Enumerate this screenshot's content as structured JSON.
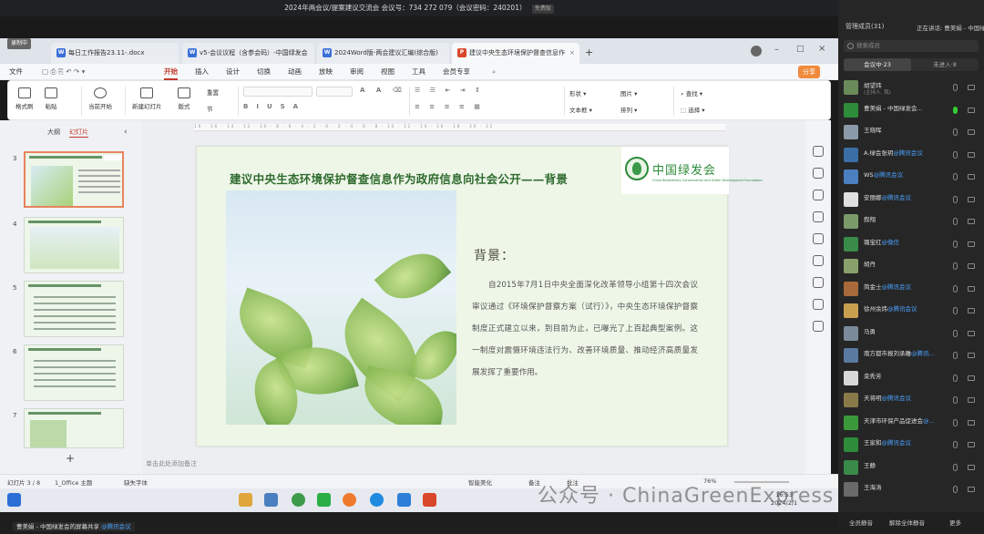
{
  "meeting": {
    "title": "2024年两会议/提案建议交流会  会议号：734 272 079（会议密码：240201）",
    "tag": "免费版",
    "recording_label": "录制中"
  },
  "tabs": [
    {
      "label": "每日工作报告23.11-.docx",
      "icon": "W"
    },
    {
      "label": "v5-会议议程（含参会码）-中国绿发会",
      "icon": "W"
    },
    {
      "label": "2024Word版-两会建议汇编(综合版)",
      "icon": "W"
    },
    {
      "label": "建议中央生态环境保护督查信息作",
      "icon": "P"
    }
  ],
  "menu": {
    "file": "文件",
    "items": [
      "开始",
      "插入",
      "设计",
      "切换",
      "动画",
      "放映",
      "审阅",
      "视图",
      "工具",
      "会员专享"
    ],
    "share": "分享"
  },
  "ribbon": {
    "format_painter": "格式刷",
    "paste": "粘贴",
    "play_from_current": "当前开始",
    "new_slide": "新建幻灯片",
    "layout": "版式",
    "reset": "重置",
    "section": "节",
    "shape": "形状",
    "picture": "图片",
    "textbox": "文本框",
    "arrange": "排列",
    "find": "查找",
    "select": "选择"
  },
  "panel": {
    "outline_tab": "大纲",
    "slides_tab": "幻灯片"
  },
  "thumbnails": [
    {
      "num": "3"
    },
    {
      "num": "4"
    },
    {
      "num": "5"
    },
    {
      "num": "6"
    },
    {
      "num": "7"
    }
  ],
  "slide": {
    "title": "建议中央生态环境保护督查信息作为政府信息向社会公开——背景",
    "logo_text": "中国绿发会",
    "logo_sub": "China Biodiversity Conservation and Green Development Foundation",
    "heading": "背景：",
    "body": "自2015年7月1日中央全面深化改革领导小组第十四次会议审议通过《环境保护督察方案（试行）》，中央生态环境保护督察制度正式建立以来，到目前为止，已曝光了上百起典型案例。这一制度对震慑环境违法行为、改善环境质量、推动经济高质量发展发挥了重要作用。"
  },
  "notes_placeholder": "单击此处添加备注",
  "status": {
    "slide_count": "幻灯片 3 / 8",
    "theme": "1_Office 主题",
    "font_missing": "缺失字体",
    "smart_beautify": "智能美化",
    "notes": "备注",
    "comments": "批注",
    "zoom": "76%"
  },
  "clock": {
    "time": "16:53",
    "date": "2024/2/1"
  },
  "presenter": {
    "name": "曹美娟 - 中国绿发会的屏幕共享",
    "source": "@腾讯会议"
  },
  "watermark": "公众号 · ChinaGreenExpress",
  "sidebar": {
    "members": "管理成员(31)",
    "speaking": "正在讲话: 曹美娟 - 中国绿",
    "search_placeholder": "搜索成员",
    "tab_in": "会议中·23",
    "tab_out": "未进入·8",
    "participants": [
      {
        "name": "胡望玮",
        "sub": "(主持人, 我)",
        "color": "#6a8a5a"
      },
      {
        "name": "曹美娟 - 中国绿发会...",
        "sub": "",
        "color": "#2d8b3a",
        "mic_on": true
      },
      {
        "name": "王晓晖",
        "sub": "",
        "color": "#8a9aa8"
      },
      {
        "name": "A.绿会张玥",
        "suffix": "@腾讯会议",
        "color": "#3a6ea5"
      },
      {
        "name": "WS",
        "suffix": "@腾讯会议",
        "color": "#4a7fc0"
      },
      {
        "name": "安丽娜",
        "suffix": "@腾讯会议",
        "color": "#e0e0e0"
      },
      {
        "name": "叙翔",
        "sub": "",
        "color": "#7a9a6a"
      },
      {
        "name": "璐宝红",
        "suffix": "@微信",
        "color": "#3a8a4a"
      },
      {
        "name": "胡丹",
        "sub": "",
        "color": "#8aa06a"
      },
      {
        "name": "简金士",
        "suffix": "@腾讯会议",
        "color": "#a86a3a"
      },
      {
        "name": "徐州余炜",
        "suffix": "@腾讯会议",
        "color": "#c8a050"
      },
      {
        "name": "马勇",
        "sub": "",
        "color": "#7a8a9a"
      },
      {
        "name": "南方都市报刘承雕",
        "suffix": "@腾讯...",
        "color": "#5a7aa0"
      },
      {
        "name": "栾秀芳",
        "sub": "",
        "color": "#d8d8d8"
      },
      {
        "name": "天将明",
        "suffix": "@腾讯会议",
        "color": "#8a7a4a"
      },
      {
        "name": "天津市环保产品促进会",
        "suffix": "@...",
        "color": "#3a9a3a"
      },
      {
        "name": "王家和",
        "suffix": "@腾讯会议",
        "color": "#2d8b3a"
      },
      {
        "name": "王静",
        "sub": "",
        "color": "#3a8a4a"
      },
      {
        "name": "王海涛",
        "sub": "",
        "color": "#6a6a6a"
      }
    ],
    "foot_all": "全员静音",
    "foot_mute": "解除全体静音",
    "foot_more": "更多"
  }
}
